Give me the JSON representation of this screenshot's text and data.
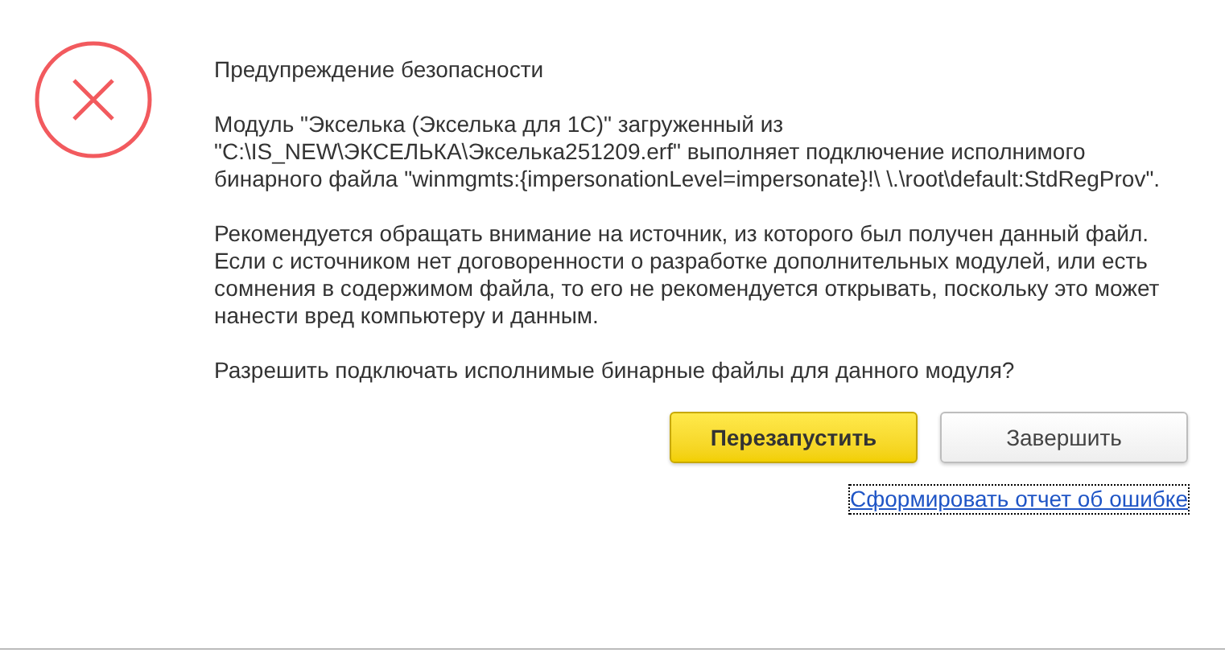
{
  "dialog": {
    "title": "Предупреждение безопасности",
    "paragraphs": [
      "Модуль \"Экселька (Экселька для 1С)\" загруженный из \"C:\\IS_NEW\\ЭКСЕЛЬКА\\Экселька251209.erf\" выполняет подключение исполнимого бинарного файла \"winmgmts:{impersonationLevel=impersonate}!\\ \\.\\root\\default:StdRegProv\".",
      "Рекомендуется обращать внимание на источник, из которого был получен данный файл. Если с источником нет договоренности о разработке дополнительных модулей, или есть сомнения в содержимом файла, то его не рекомендуется открывать, поскольку это может нанести вред компьютеру и данным.",
      "Разрешить подключать исполнимые бинарные файлы для данного модуля?"
    ],
    "buttons": [
      {
        "label": "Перезапустить",
        "kind": "primary"
      },
      {
        "label": "Завершить",
        "kind": "default"
      }
    ],
    "link": "Сформировать отчет об ошибке"
  }
}
